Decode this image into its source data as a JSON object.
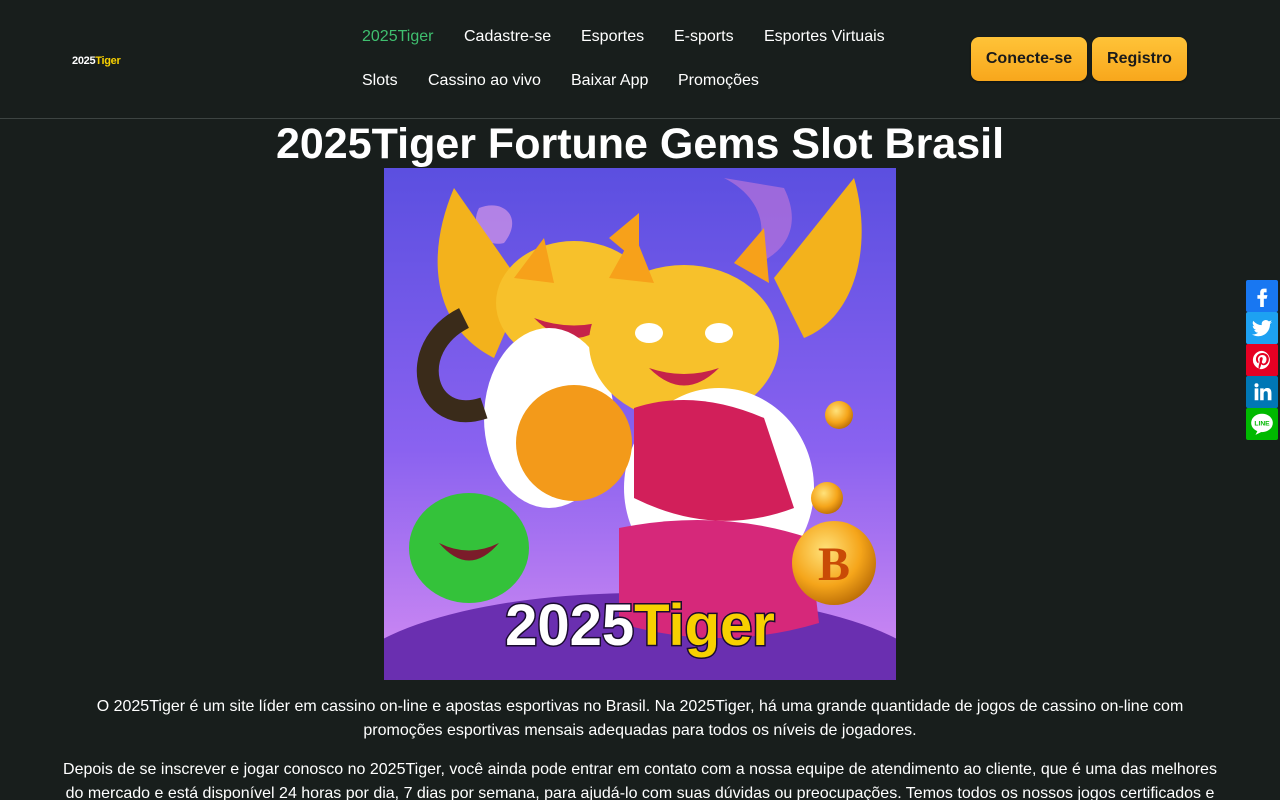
{
  "header": {
    "logo": {
      "num": "2025",
      "tiger": "Tiger"
    },
    "nav": [
      "2025Tiger",
      "Cadastre-se",
      "Esportes",
      "E-sports",
      "Esportes Virtuais",
      "Slots",
      "Cassino ao vivo",
      "Baixar App",
      "Promoções"
    ],
    "login_label": "Conecte-se",
    "register_label": "Registro"
  },
  "main": {
    "title": "2025Tiger Fortune Gems Slot Brasil",
    "hero_brand": {
      "num": "2025",
      "tiger": "Tiger"
    },
    "hero_coin": "B",
    "paragraphs": [
      "O 2025Tiger é um site líder em cassino on-line e apostas esportivas no Brasil. Na 2025Tiger, há uma grande quantidade de jogos de cassino on-line com promoções esportivas mensais adequadas para todos os níveis de jogadores.",
      "Depois de se inscrever e jogar conosco no 2025Tiger, você ainda pode entrar em contato com a nossa equipe de atendimento ao cliente, que é uma das melhores do mercado e está disponível 24 horas por dia, 7 dias por semana, para ajudá-lo com suas dúvidas ou preocupações. Temos todos os nossos jogos certificados e"
    ]
  },
  "share": [
    {
      "icon": "facebook-icon",
      "color": "#1877f2"
    },
    {
      "icon": "twitter-icon",
      "color": "#1da1f2"
    },
    {
      "icon": "pinterest-icon",
      "color": "#e60023"
    },
    {
      "icon": "linkedin-icon",
      "color": "#0077b5"
    },
    {
      "icon": "line-icon",
      "color": "#00b900"
    }
  ],
  "colors": {
    "accent": "#3fbf6f",
    "button": "#ffb52b",
    "background": "#181e1c"
  }
}
